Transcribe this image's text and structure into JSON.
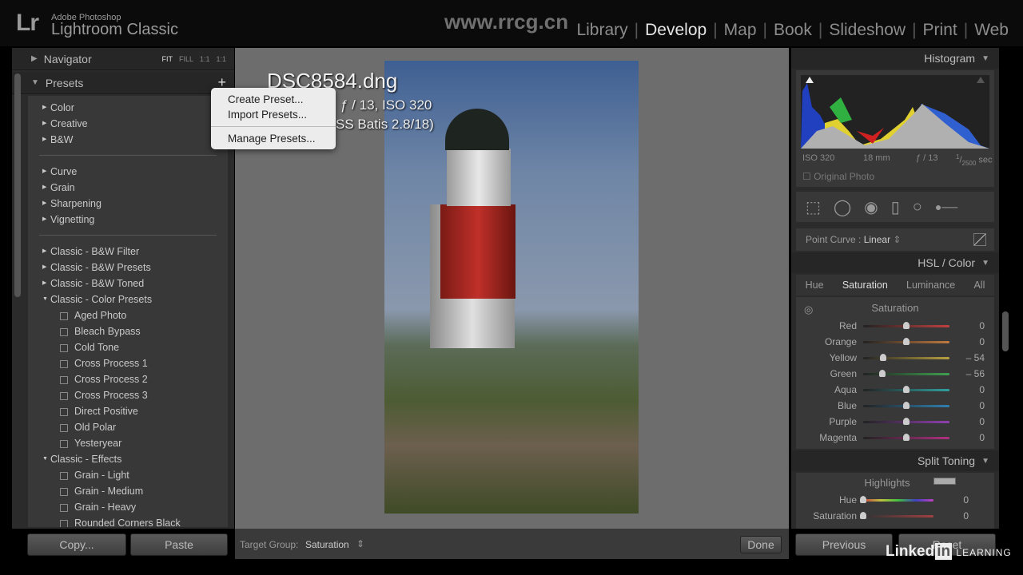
{
  "app": {
    "logo": "Lr",
    "vendor": "Adobe Photoshop",
    "product": "Lightroom Classic",
    "watermark": "www.rrcg.cn"
  },
  "modules": [
    {
      "label": "Library",
      "active": false
    },
    {
      "label": "Develop",
      "active": true
    },
    {
      "label": "Map",
      "active": false
    },
    {
      "label": "Book",
      "active": false
    },
    {
      "label": "Slideshow",
      "active": false
    },
    {
      "label": "Print",
      "active": false
    },
    {
      "label": "Web",
      "active": false
    }
  ],
  "left": {
    "navigator": {
      "title": "Navigator",
      "options": [
        "FIT",
        "FILL",
        "1:1",
        "1:1"
      ]
    },
    "presets": {
      "title": "Presets",
      "add_icon": "plus-icon",
      "groups": [
        [
          "Color",
          "Creative",
          "B&W"
        ],
        [
          "Curve",
          "Grain",
          "Sharpening",
          "Vignetting"
        ]
      ],
      "classic_folders": [
        "Classic - B&W Filter",
        "Classic - B&W Presets",
        "Classic - B&W Toned"
      ],
      "color_presets": {
        "label": "Classic - Color Presets",
        "items": [
          "Aged Photo",
          "Bleach Bypass",
          "Cold Tone",
          "Cross Process 1",
          "Cross Process 2",
          "Cross Process 3",
          "Direct Positive",
          "Old Polar",
          "Yesteryear"
        ]
      },
      "effects": {
        "label": "Classic - Effects",
        "items": [
          "Grain - Light",
          "Grain - Medium",
          "Grain - Heavy",
          "Rounded Corners Black"
        ]
      }
    },
    "copy": "Copy...",
    "paste": "Paste"
  },
  "context_menu": {
    "items": [
      "Create Preset...",
      "Import Presets...",
      "Manage Presets..."
    ]
  },
  "photo": {
    "filename": "DSC8584.dng",
    "exposure": "ƒ / 13, ISO 320",
    "lens": "SS Batis 2.8/18)"
  },
  "toolbar": {
    "target_label": "Target Group:",
    "target_value": "Saturation",
    "done": "Done"
  },
  "right": {
    "histogram": {
      "title": "Histogram",
      "iso": "ISO 320",
      "focal": "18 mm",
      "aperture": "ƒ / 13",
      "shutter_num": "1",
      "shutter_den": "2500",
      "shutter_unit": "sec",
      "original_photo": "Original Photo"
    },
    "point_curve": {
      "label": "Point Curve :",
      "value": "Linear"
    },
    "hsl": {
      "title": "HSL / Color",
      "tabs": [
        "Hue",
        "Saturation",
        "Luminance",
        "All"
      ],
      "active_tab": "Saturation",
      "section": "Saturation",
      "sliders": [
        {
          "label": "Red",
          "value": "0",
          "v": 0,
          "color": "#c04040"
        },
        {
          "label": "Orange",
          "value": "0",
          "v": 0,
          "color": "#c07a40"
        },
        {
          "label": "Yellow",
          "value": "– 54",
          "v": -54,
          "color": "#b8a040"
        },
        {
          "label": "Green",
          "value": "– 56",
          "v": -56,
          "color": "#40a050"
        },
        {
          "label": "Aqua",
          "value": "0",
          "v": 0,
          "color": "#30a0a0"
        },
        {
          "label": "Blue",
          "value": "0",
          "v": 0,
          "color": "#3080b0"
        },
        {
          "label": "Purple",
          "value": "0",
          "v": 0,
          "color": "#9040b0"
        },
        {
          "label": "Magenta",
          "value": "0",
          "v": 0,
          "color": "#b03080"
        }
      ]
    },
    "split_toning": {
      "title": "Split Toning",
      "highlights": "Highlights",
      "sliders": [
        {
          "label": "Hue",
          "value": "0"
        },
        {
          "label": "Saturation",
          "value": "0"
        }
      ]
    },
    "previous": "Previous",
    "reset": "Reset"
  },
  "branding": {
    "linkedin": "Linked",
    "in": "in",
    "learning": "LEARNING"
  }
}
